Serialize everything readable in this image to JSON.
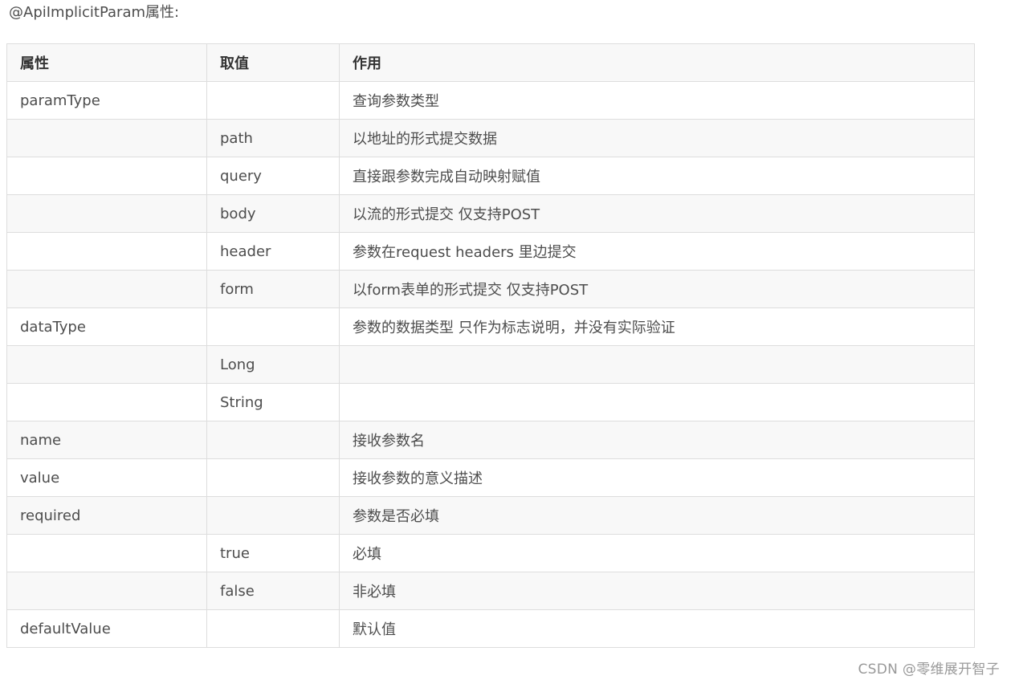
{
  "heading": "@ApiImplicitParam属性:",
  "table": {
    "headers": [
      "属性",
      "取值",
      "作用"
    ],
    "rows": [
      [
        "paramType",
        "",
        "查询参数类型"
      ],
      [
        "",
        "path",
        "以地址的形式提交数据"
      ],
      [
        "",
        "query",
        "直接跟参数完成自动映射赋值"
      ],
      [
        "",
        "body",
        "以流的形式提交 仅支持POST"
      ],
      [
        "",
        "header",
        "参数在request headers 里边提交"
      ],
      [
        "",
        "form",
        "以form表单的形式提交 仅支持POST"
      ],
      [
        "dataType",
        "",
        "参数的数据类型 只作为标志说明，并没有实际验证"
      ],
      [
        "",
        "Long",
        ""
      ],
      [
        "",
        "String",
        ""
      ],
      [
        "name",
        "",
        "接收参数名"
      ],
      [
        "value",
        "",
        "接收参数的意义描述"
      ],
      [
        "required",
        "",
        "参数是否必填"
      ],
      [
        "",
        "true",
        "必填"
      ],
      [
        "",
        "false",
        "非必填"
      ],
      [
        "defaultValue",
        "",
        "默认值"
      ]
    ]
  },
  "watermark": "CSDN @零维展开智子"
}
